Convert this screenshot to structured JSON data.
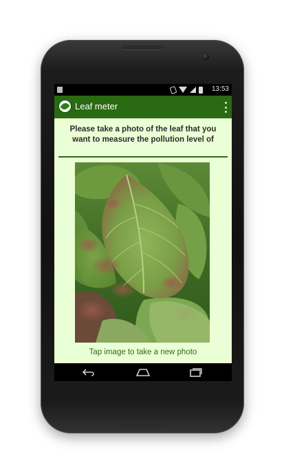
{
  "status_bar": {
    "time": "13:53"
  },
  "app": {
    "title": "Leaf meter"
  },
  "main": {
    "prompt": "Please take a photo of the leaf that you want to measure the pollution level of",
    "hint": "Tap image to take a new photo"
  },
  "colors": {
    "action_bar": "#2a6a12",
    "content_bg": "#ebffd6",
    "divider": "#2b6a10",
    "hint_text": "#2f6a18"
  },
  "icons": {
    "app": "leaf-app-icon",
    "overflow": "overflow-menu-icon",
    "back": "back-icon",
    "home": "home-icon",
    "recent": "recent-apps-icon"
  }
}
